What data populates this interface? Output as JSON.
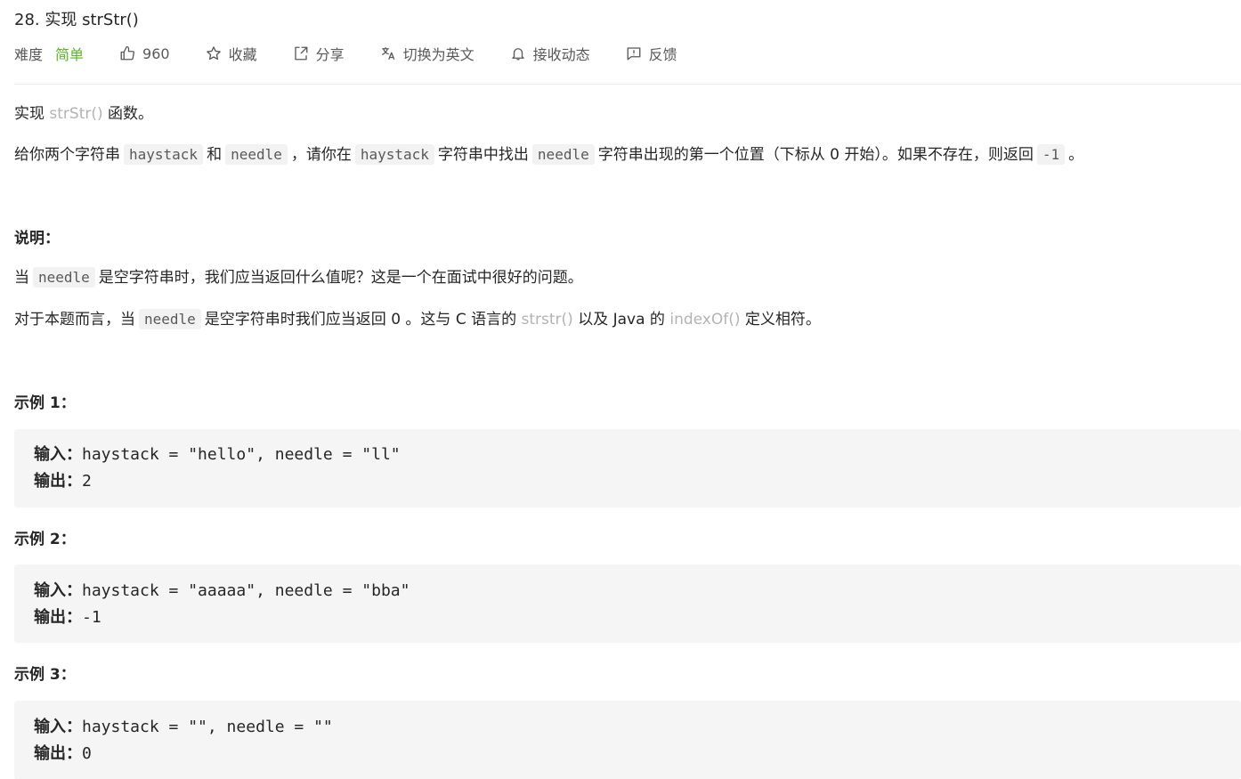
{
  "problem": {
    "title": "28. 实现 strStr()"
  },
  "meta": {
    "difficulty_label": "难度",
    "difficulty_value": "简单",
    "likes": "960",
    "favorite": "收藏",
    "share": "分享",
    "switch_lang": "切换为英文",
    "subscribe": "接收动态",
    "feedback": "反馈",
    "colors": {
      "easy": "#5ab726",
      "link": "#b3b3b3"
    }
  },
  "desc": {
    "p1_a": "实现",
    "p1_link": "strStr()",
    "p1_b": "函数。",
    "p2_a": "给你两个字符串",
    "p2_code1": "haystack",
    "p2_b": "和",
    "p2_code2": "needle",
    "p2_c": "，请你在",
    "p2_code3": "haystack",
    "p2_d": "字符串中找出",
    "p2_code4": "needle",
    "p2_e": "字符串出现的第一个位置（下标从 0 开始）。如果不存在，则返回",
    "p2_code5": "-1",
    "p2_f": "。",
    "note_title": "说明：",
    "p3_a": "当",
    "p3_code": "needle",
    "p3_b": "是空字符串时，我们应当返回什么值呢？这是一个在面试中很好的问题。",
    "p4_a": "对于本题而言，当",
    "p4_code": "needle",
    "p4_b": "是空字符串时我们应当返回 0 。这与 C 语言的",
    "p4_link1": "strstr()",
    "p4_c": "以及 Java 的",
    "p4_link2": "indexOf()",
    "p4_d": "定义相符。"
  },
  "examples": [
    {
      "title": "示例 1：",
      "input_label": "输入：",
      "input": "haystack = \"hello\", needle = \"ll\"",
      "output_label": "输出：",
      "output": "2"
    },
    {
      "title": "示例 2：",
      "input_label": "输入：",
      "input": "haystack = \"aaaaa\", needle = \"bba\"",
      "output_label": "输出：",
      "output": "-1"
    },
    {
      "title": "示例 3：",
      "input_label": "输入：",
      "input": "haystack = \"\", needle = \"\"",
      "output_label": "输出：",
      "output": "0"
    }
  ]
}
